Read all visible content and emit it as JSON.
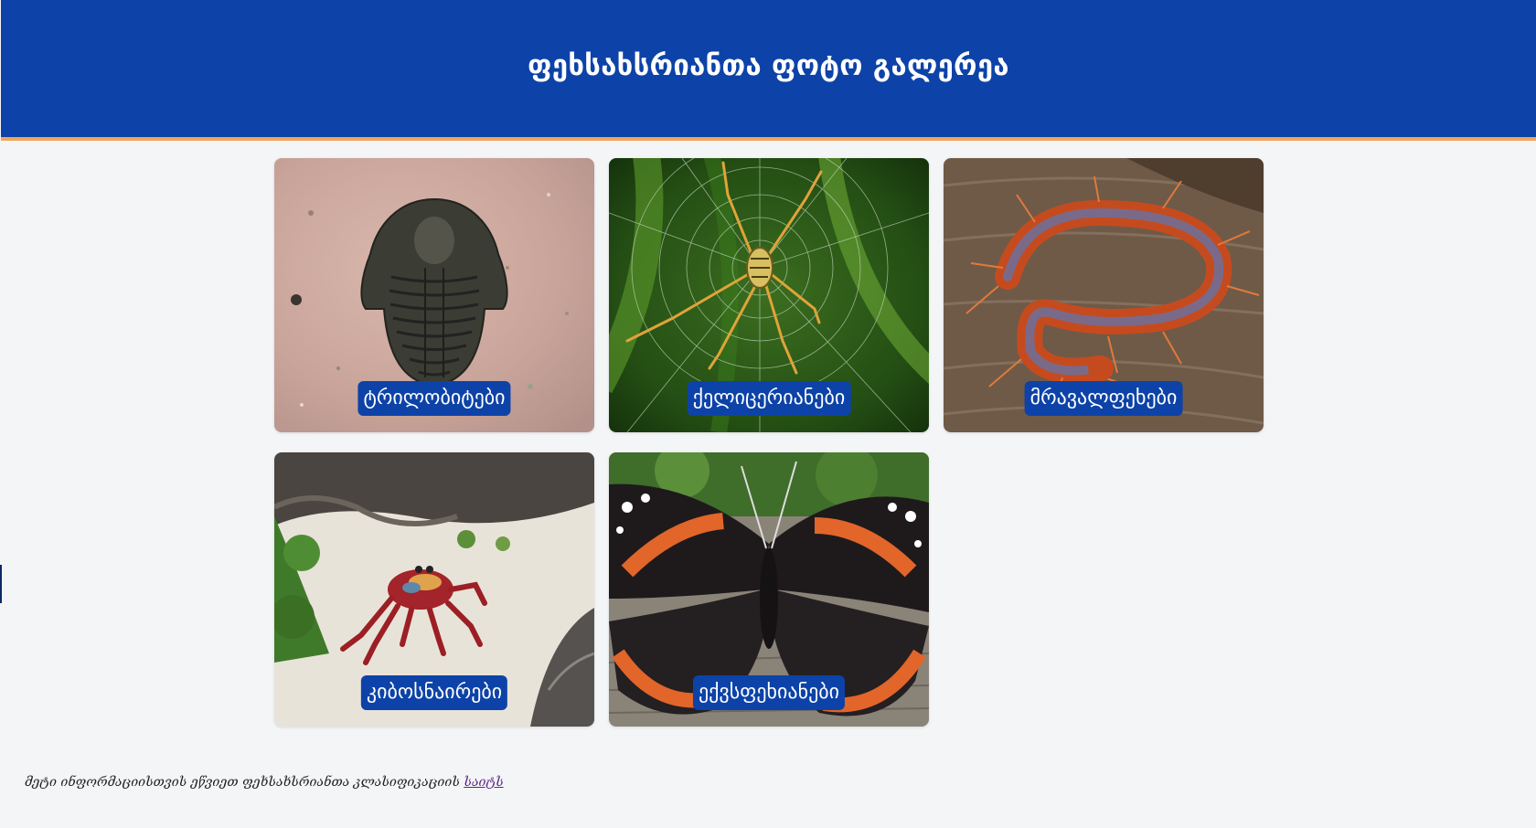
{
  "header": {
    "title": "ფეხსახსრიანთა ფოტო გალერეა"
  },
  "gallery": {
    "items": [
      {
        "label": "ტრილობიტები",
        "image": "trilobite-fossil"
      },
      {
        "label": "ქელიცერიანები",
        "image": "spider-on-web"
      },
      {
        "label": "მრავალფეხები",
        "image": "centipede"
      },
      {
        "label": "კიბოსნაირები",
        "image": "red-crab"
      },
      {
        "label": "ექვსფეხიანები",
        "image": "butterfly"
      }
    ]
  },
  "footer": {
    "text": "მეტი ინფორმაციისთვის ეწვიეთ ფეხსახსრიანთა კლასიფიკაციის ",
    "link_text": "საიტს"
  },
  "colors": {
    "header_bg": "#0d43a8",
    "header_border": "#f0a75a",
    "page_bg": "#f4f5f7",
    "label_bg": "#0d43a8",
    "link": "#5b2a86"
  }
}
